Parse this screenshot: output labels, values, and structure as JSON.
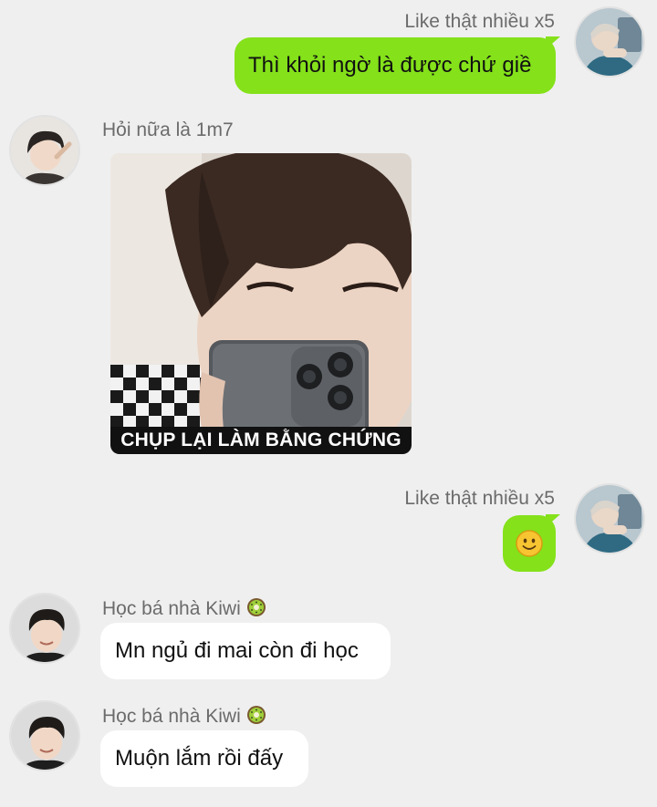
{
  "colors": {
    "background": "#efefef",
    "outgoing_bubble": "#84e11a",
    "incoming_bubble": "#ffffff",
    "name_text": "#6b6b6b"
  },
  "messages": [
    {
      "direction": "outgoing",
      "sender": "Like thật nhiều x5",
      "text": "Thì khỏi ngờ là được chứ giề",
      "avatar": "profile-photo"
    },
    {
      "direction": "incoming",
      "sender": "Hỏi nữa là 1m7",
      "type": "sticker",
      "sticker_caption": "CHỤP LẠI LÀM BẰNG CHỨNG",
      "avatar": "profile-photo"
    },
    {
      "direction": "outgoing",
      "sender": "Like thật nhiều x5",
      "type": "emoji",
      "emoji": "☺",
      "avatar": "profile-photo"
    },
    {
      "direction": "incoming",
      "sender": "Học bá nhà Kiwi",
      "sender_badge": "kiwi-icon",
      "text": "Mn ngủ đi mai còn đi học",
      "avatar": "profile-photo"
    },
    {
      "direction": "incoming",
      "sender": "Học bá nhà Kiwi",
      "sender_badge": "kiwi-icon",
      "text": "Muộn lắm rồi đấy",
      "avatar": "profile-photo"
    }
  ]
}
